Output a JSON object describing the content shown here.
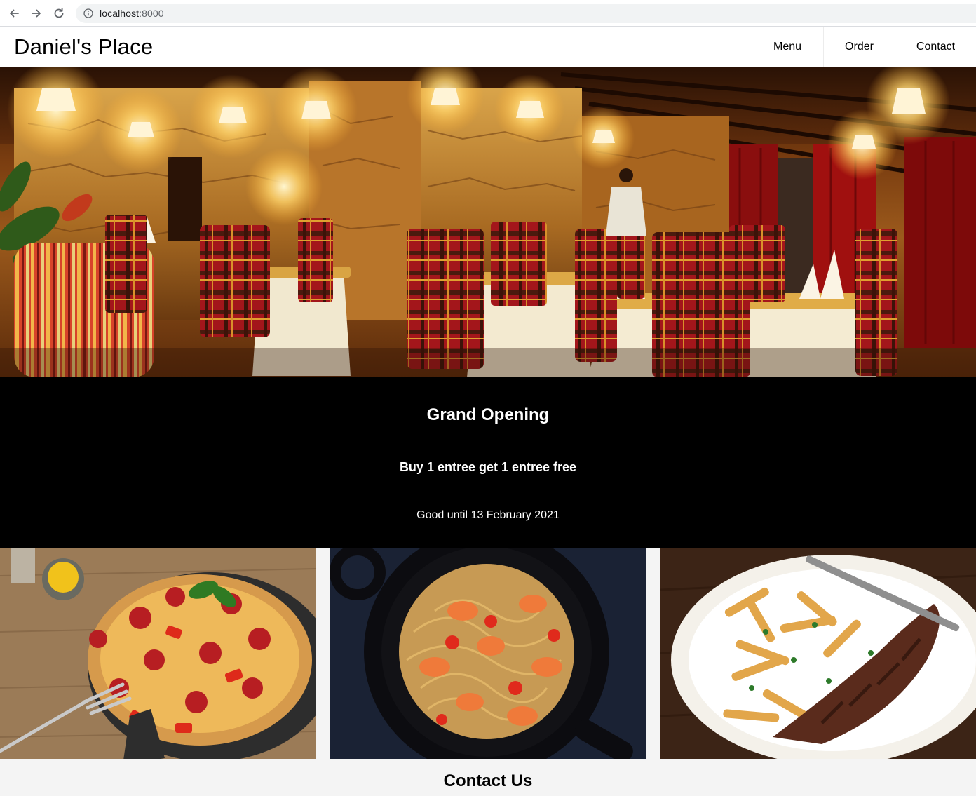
{
  "browser": {
    "url_host": "localhost",
    "url_port": ":8000"
  },
  "site": {
    "brand": "Daniel's Place",
    "nav": [
      {
        "label": "Menu"
      },
      {
        "label": "Order"
      },
      {
        "label": "Contact"
      }
    ]
  },
  "promo": {
    "title": "Grand Opening",
    "offer": "Buy 1 entree get 1 entree free",
    "valid": "Good until 13 February 2021"
  },
  "contact": {
    "title": "Contact Us"
  },
  "colors": {
    "promo_bg": "#000000",
    "header_bg": "#ffffff",
    "page_bg": "#f4f4f4"
  }
}
